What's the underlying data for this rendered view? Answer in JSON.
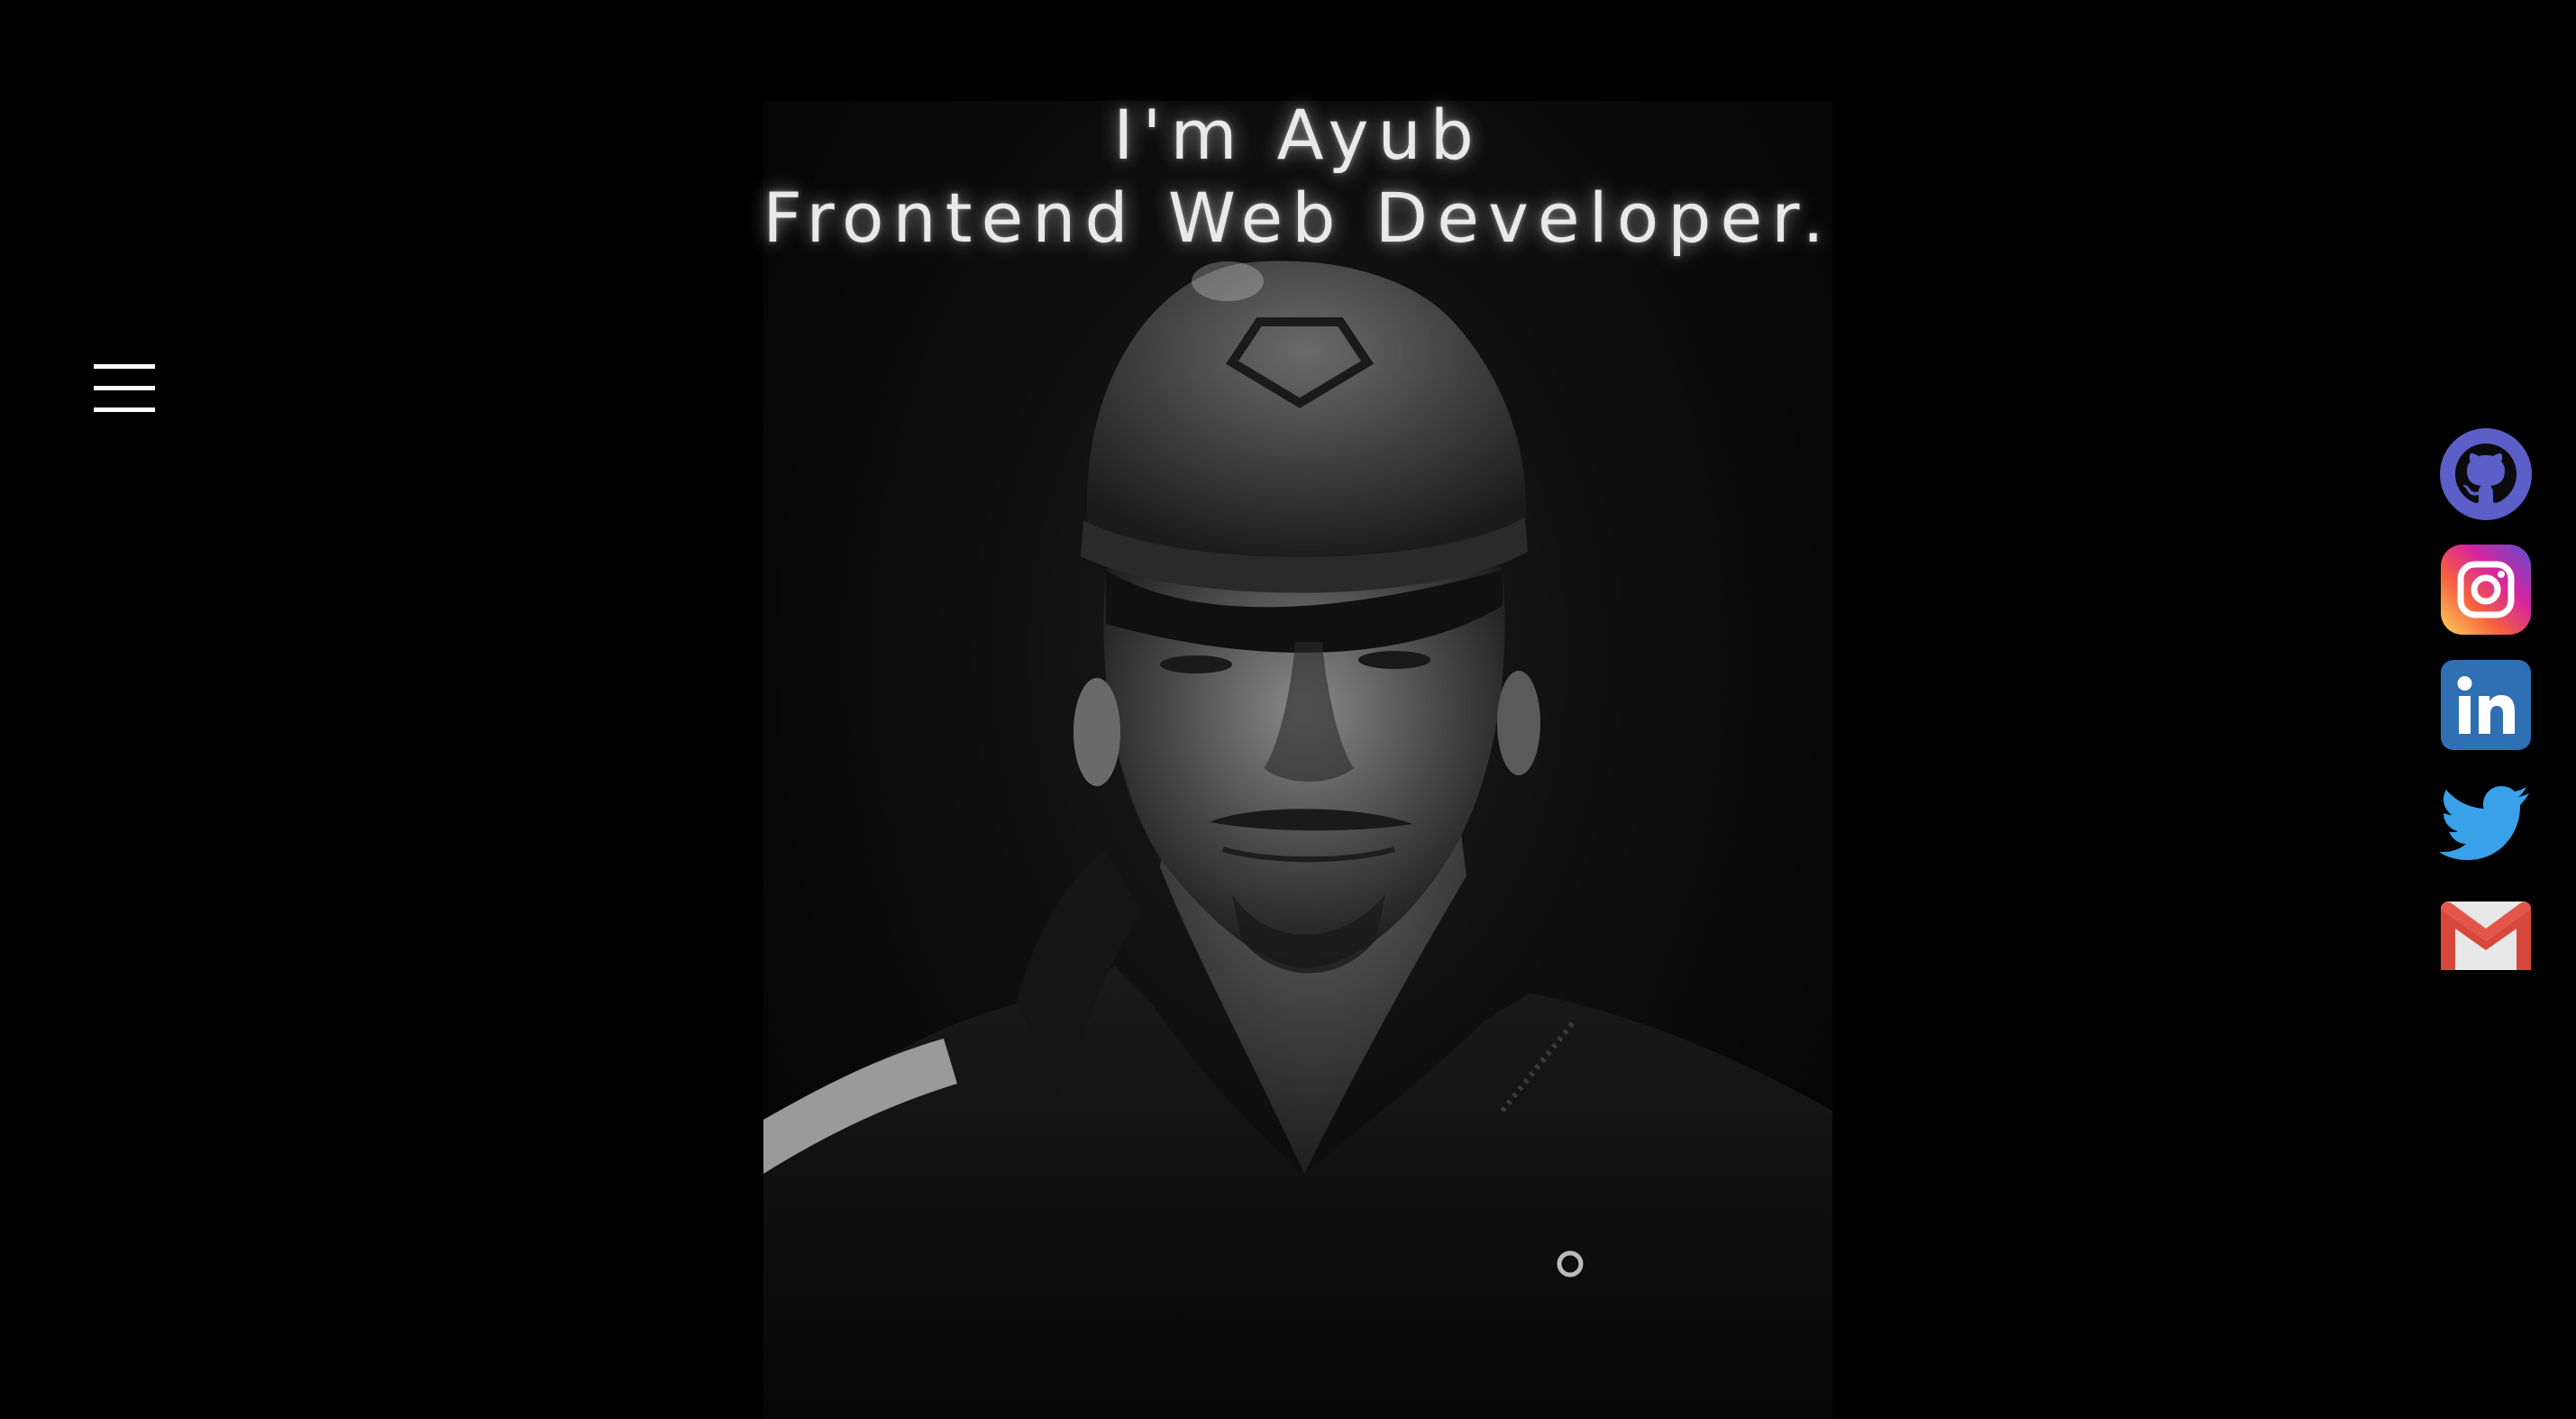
{
  "hero": {
    "line1": "I'm Ayub",
    "line2": "Frontend Web Developer."
  },
  "nav": {
    "menu_icon": "hamburger-menu-icon"
  },
  "social": [
    {
      "name": "github",
      "icon": "github-icon",
      "color": "#5b5fc7"
    },
    {
      "name": "instagram",
      "icon": "instagram-icon",
      "color": "#d6249f"
    },
    {
      "name": "linkedin",
      "icon": "linkedin-icon",
      "color": "#2f6fb3"
    },
    {
      "name": "twitter",
      "icon": "twitter-icon",
      "color": "#3aa0ea"
    },
    {
      "name": "gmail",
      "icon": "gmail-icon",
      "color": "#d7473a"
    }
  ],
  "colors": {
    "background": "#000000",
    "text": "#e9e9e9",
    "menu": "#ffffff"
  }
}
